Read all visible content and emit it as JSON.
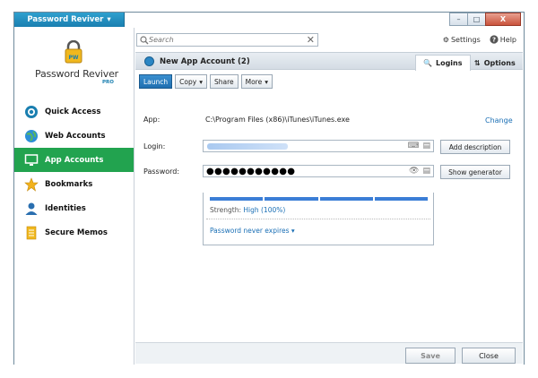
{
  "app": {
    "menu_label": "Password Reviver",
    "logo_text": "Password Reviver",
    "logo_pro": "PRO"
  },
  "window_buttons": {
    "minimize": "–",
    "maximize": "□",
    "close": "X"
  },
  "sidebar": {
    "items": [
      {
        "label": "Quick Access",
        "icon": "quick-access-icon",
        "active": false
      },
      {
        "label": "Web Accounts",
        "icon": "globe-icon",
        "active": false
      },
      {
        "label": "App Accounts",
        "icon": "monitor-icon",
        "active": true
      },
      {
        "label": "Bookmarks",
        "icon": "star-icon",
        "active": false
      },
      {
        "label": "Identities",
        "icon": "person-icon",
        "active": false
      },
      {
        "label": "Secure Memos",
        "icon": "memo-icon",
        "active": false
      }
    ]
  },
  "search": {
    "placeholder": "Search"
  },
  "top_links": {
    "settings": "Settings",
    "help": "Help"
  },
  "header": {
    "title": "New App Account (2)",
    "tab_logins": "Logins",
    "tab_options": "Options"
  },
  "toolbar": {
    "launch": "Launch",
    "copy": "Copy",
    "share": "Share",
    "more": "More"
  },
  "form": {
    "app_label": "App:",
    "app_value": "C:\\Program Files (x86)\\iTunes\\iTunes.exe",
    "change_link": "Change",
    "login_label": "Login:",
    "password_label": "Password:",
    "password_value": "●●●●●●●●●●●",
    "add_description": "Add description",
    "show_generator": "Show generator",
    "strength_label": "Strength:",
    "strength_value": "High (100%)",
    "strength_level": 1.0,
    "expire_text": "Password never expires"
  },
  "footer": {
    "save": "Save",
    "close": "Close"
  },
  "colors": {
    "accent_green": "#22a34f",
    "accent_blue": "#1a7fb0",
    "link": "#1a6fb5"
  }
}
